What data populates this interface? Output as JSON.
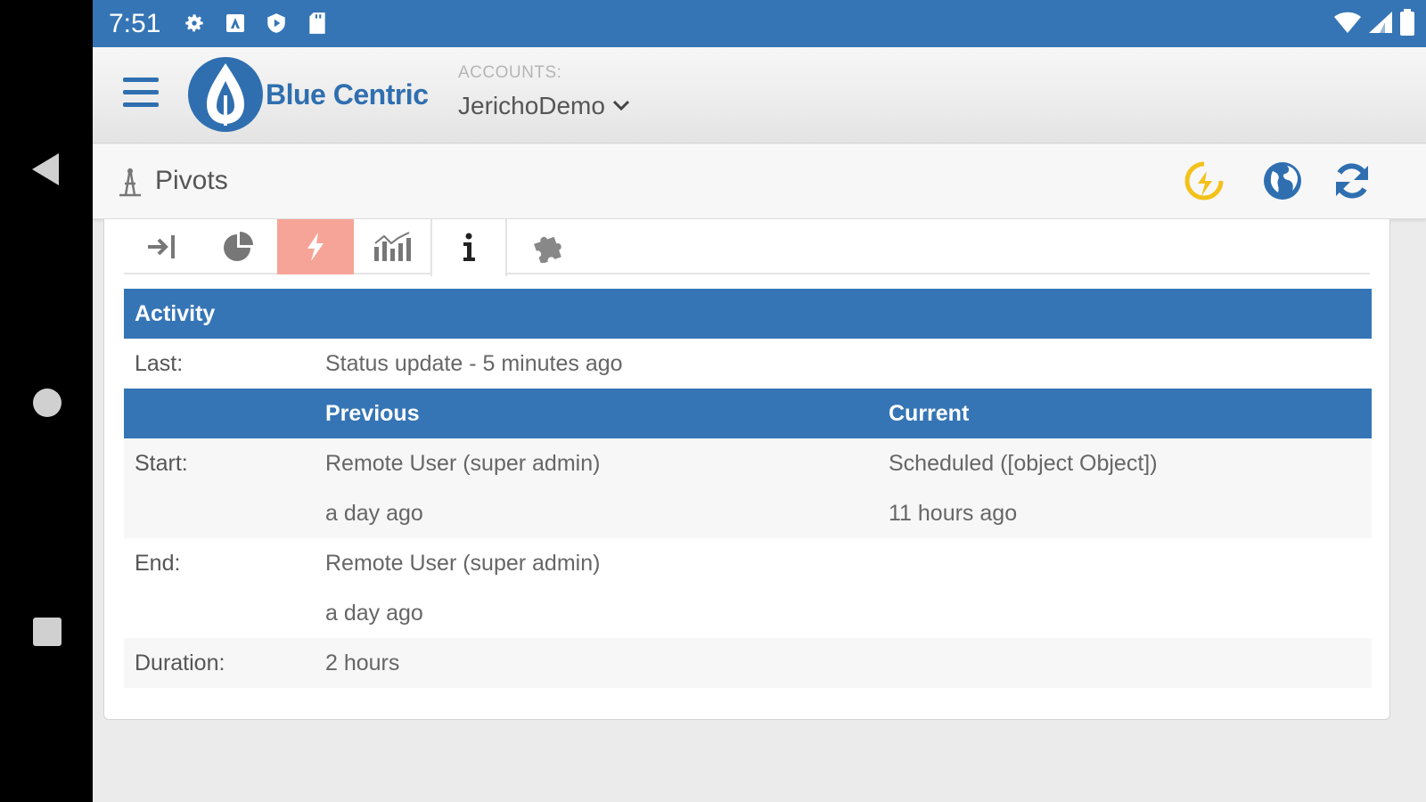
{
  "status_bar": {
    "time": "7:51",
    "left_icons": [
      "gear-icon",
      "a-app-icon",
      "shield-play-icon",
      "sd-card-icon"
    ],
    "right_icons": [
      "wifi-icon",
      "signal-icon",
      "battery-icon"
    ]
  },
  "header": {
    "brand": "Blue Centric",
    "accounts_label": "ACCOUNTS:",
    "account_name": "JerichoDemo"
  },
  "subheader": {
    "title": "Pivots",
    "buttons": [
      "power-bolt-icon",
      "globe-icon",
      "refresh-icon"
    ]
  },
  "tabs": [
    "sign-in-icon",
    "pie-chart-icon",
    "bolt-icon",
    "bar-chart-icon",
    "info-icon",
    "puzzle-icon"
  ],
  "activity": {
    "section_title": "Activity",
    "last_label": "Last:",
    "last_value": "Status update - 5 minutes ago",
    "col_previous": "Previous",
    "col_current": "Current",
    "start_label": "Start:",
    "start_prev_user": "Remote User (super admin)",
    "start_prev_time": "a day ago",
    "start_curr_status": "Scheduled ([object Object])",
    "start_curr_time": "11 hours ago",
    "end_label": "End:",
    "end_prev_user": "Remote User (super admin)",
    "end_prev_time": "a day ago",
    "duration_label": "Duration:",
    "duration_value": "2 hours"
  },
  "colors": {
    "primary": "#3575b5",
    "accent_yellow": "#f2c21b",
    "tab_active": "#f6a497"
  }
}
